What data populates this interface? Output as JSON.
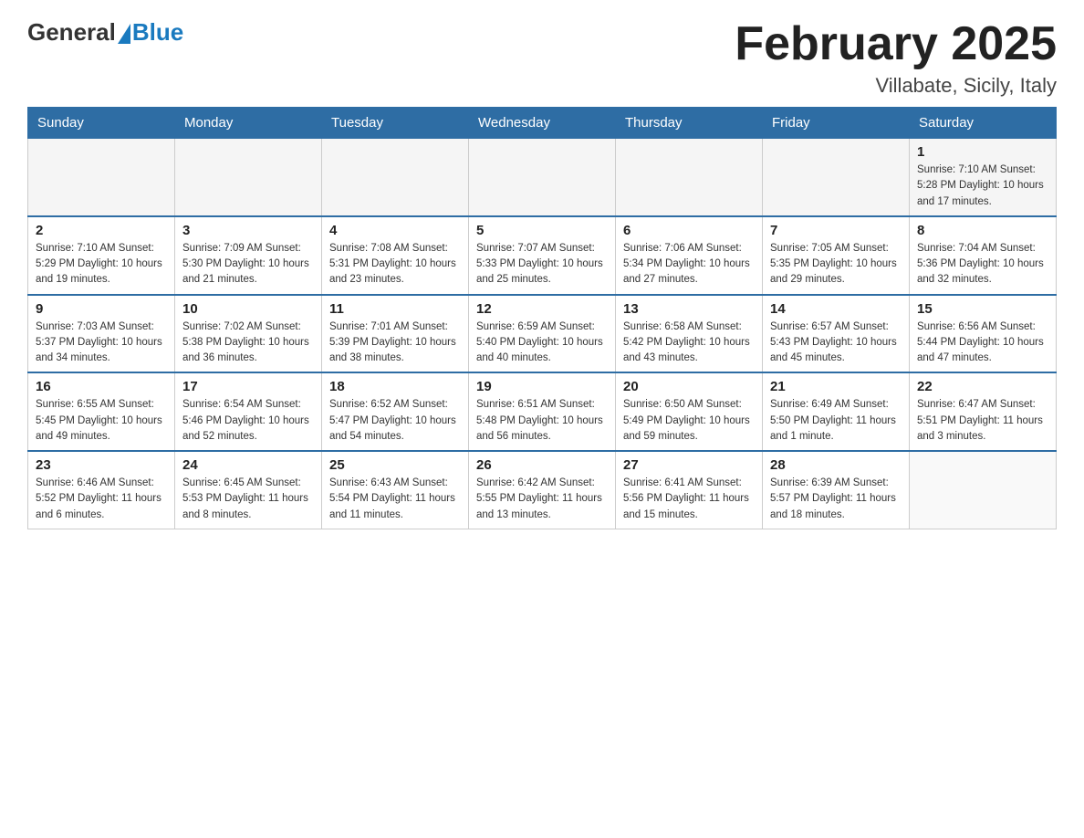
{
  "header": {
    "logo_general": "General",
    "logo_blue": "Blue",
    "title": "February 2025",
    "subtitle": "Villabate, Sicily, Italy"
  },
  "days_of_week": [
    "Sunday",
    "Monday",
    "Tuesday",
    "Wednesday",
    "Thursday",
    "Friday",
    "Saturday"
  ],
  "weeks": [
    [
      {
        "day": "",
        "info": ""
      },
      {
        "day": "",
        "info": ""
      },
      {
        "day": "",
        "info": ""
      },
      {
        "day": "",
        "info": ""
      },
      {
        "day": "",
        "info": ""
      },
      {
        "day": "",
        "info": ""
      },
      {
        "day": "1",
        "info": "Sunrise: 7:10 AM\nSunset: 5:28 PM\nDaylight: 10 hours and 17 minutes."
      }
    ],
    [
      {
        "day": "2",
        "info": "Sunrise: 7:10 AM\nSunset: 5:29 PM\nDaylight: 10 hours and 19 minutes."
      },
      {
        "day": "3",
        "info": "Sunrise: 7:09 AM\nSunset: 5:30 PM\nDaylight: 10 hours and 21 minutes."
      },
      {
        "day": "4",
        "info": "Sunrise: 7:08 AM\nSunset: 5:31 PM\nDaylight: 10 hours and 23 minutes."
      },
      {
        "day": "5",
        "info": "Sunrise: 7:07 AM\nSunset: 5:33 PM\nDaylight: 10 hours and 25 minutes."
      },
      {
        "day": "6",
        "info": "Sunrise: 7:06 AM\nSunset: 5:34 PM\nDaylight: 10 hours and 27 minutes."
      },
      {
        "day": "7",
        "info": "Sunrise: 7:05 AM\nSunset: 5:35 PM\nDaylight: 10 hours and 29 minutes."
      },
      {
        "day": "8",
        "info": "Sunrise: 7:04 AM\nSunset: 5:36 PM\nDaylight: 10 hours and 32 minutes."
      }
    ],
    [
      {
        "day": "9",
        "info": "Sunrise: 7:03 AM\nSunset: 5:37 PM\nDaylight: 10 hours and 34 minutes."
      },
      {
        "day": "10",
        "info": "Sunrise: 7:02 AM\nSunset: 5:38 PM\nDaylight: 10 hours and 36 minutes."
      },
      {
        "day": "11",
        "info": "Sunrise: 7:01 AM\nSunset: 5:39 PM\nDaylight: 10 hours and 38 minutes."
      },
      {
        "day": "12",
        "info": "Sunrise: 6:59 AM\nSunset: 5:40 PM\nDaylight: 10 hours and 40 minutes."
      },
      {
        "day": "13",
        "info": "Sunrise: 6:58 AM\nSunset: 5:42 PM\nDaylight: 10 hours and 43 minutes."
      },
      {
        "day": "14",
        "info": "Sunrise: 6:57 AM\nSunset: 5:43 PM\nDaylight: 10 hours and 45 minutes."
      },
      {
        "day": "15",
        "info": "Sunrise: 6:56 AM\nSunset: 5:44 PM\nDaylight: 10 hours and 47 minutes."
      }
    ],
    [
      {
        "day": "16",
        "info": "Sunrise: 6:55 AM\nSunset: 5:45 PM\nDaylight: 10 hours and 49 minutes."
      },
      {
        "day": "17",
        "info": "Sunrise: 6:54 AM\nSunset: 5:46 PM\nDaylight: 10 hours and 52 minutes."
      },
      {
        "day": "18",
        "info": "Sunrise: 6:52 AM\nSunset: 5:47 PM\nDaylight: 10 hours and 54 minutes."
      },
      {
        "day": "19",
        "info": "Sunrise: 6:51 AM\nSunset: 5:48 PM\nDaylight: 10 hours and 56 minutes."
      },
      {
        "day": "20",
        "info": "Sunrise: 6:50 AM\nSunset: 5:49 PM\nDaylight: 10 hours and 59 minutes."
      },
      {
        "day": "21",
        "info": "Sunrise: 6:49 AM\nSunset: 5:50 PM\nDaylight: 11 hours and 1 minute."
      },
      {
        "day": "22",
        "info": "Sunrise: 6:47 AM\nSunset: 5:51 PM\nDaylight: 11 hours and 3 minutes."
      }
    ],
    [
      {
        "day": "23",
        "info": "Sunrise: 6:46 AM\nSunset: 5:52 PM\nDaylight: 11 hours and 6 minutes."
      },
      {
        "day": "24",
        "info": "Sunrise: 6:45 AM\nSunset: 5:53 PM\nDaylight: 11 hours and 8 minutes."
      },
      {
        "day": "25",
        "info": "Sunrise: 6:43 AM\nSunset: 5:54 PM\nDaylight: 11 hours and 11 minutes."
      },
      {
        "day": "26",
        "info": "Sunrise: 6:42 AM\nSunset: 5:55 PM\nDaylight: 11 hours and 13 minutes."
      },
      {
        "day": "27",
        "info": "Sunrise: 6:41 AM\nSunset: 5:56 PM\nDaylight: 11 hours and 15 minutes."
      },
      {
        "day": "28",
        "info": "Sunrise: 6:39 AM\nSunset: 5:57 PM\nDaylight: 11 hours and 18 minutes."
      },
      {
        "day": "",
        "info": ""
      }
    ]
  ]
}
